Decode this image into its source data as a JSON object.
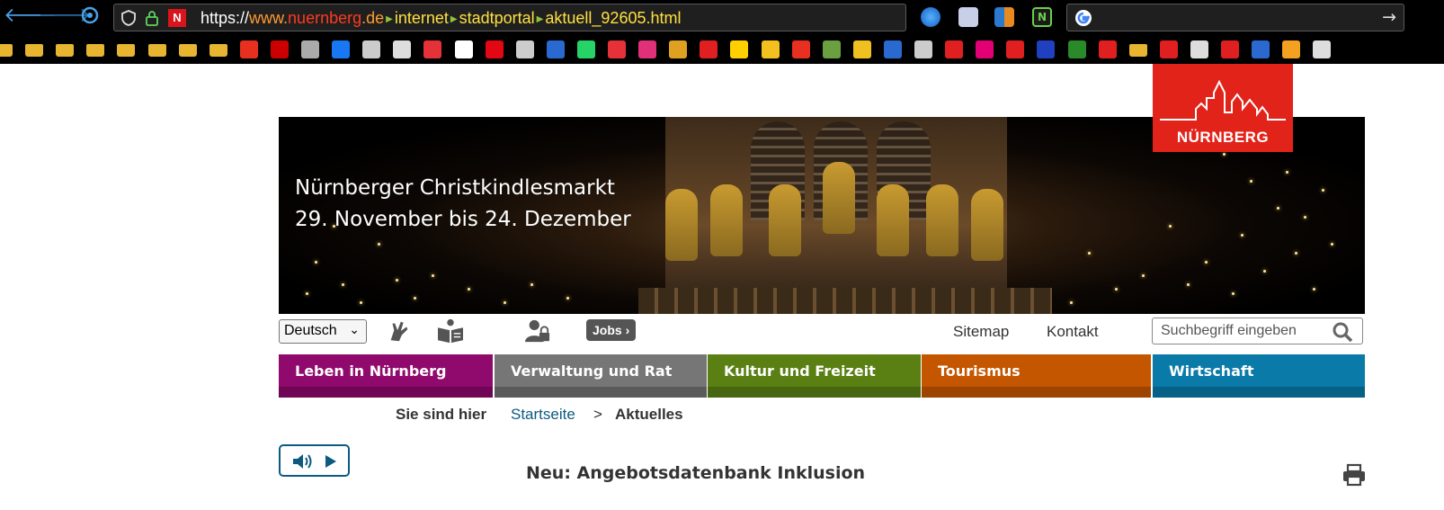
{
  "browser": {
    "url": {
      "scheme": "https://",
      "domain_prefix": "www.",
      "domain_name": "nuernberg",
      "domain_tld": ".de",
      "segments": [
        "internet",
        "stadtportal",
        "aktuell_92605.html"
      ]
    },
    "icons": [
      "back-arrow-icon",
      "forward-arrow-icon",
      "reader-icon",
      "shield-icon",
      "lock-icon",
      "site-favicon-n",
      "go-arrow-icon",
      "google-icon"
    ],
    "bookmark_count": 44
  },
  "site": {
    "logo_text": "NÜRNBERG",
    "hero": {
      "line1": "Nürnberger Christkindlesmarkt",
      "line2": "29. November bis 24. Dezember"
    },
    "tools": {
      "language": "Deutsch",
      "jobs_label": "Jobs",
      "sitemap": "Sitemap",
      "contact": "Kontakt",
      "search_placeholder": "Suchbegriff eingeben"
    },
    "nav": [
      {
        "label": "Leben in Nürnberg",
        "color": "#8f0a6c",
        "bar": "#6f0554"
      },
      {
        "label": "Verwaltung und Rat",
        "color": "#767676",
        "bar": "#5a5a5a"
      },
      {
        "label": "Kultur und Freizeit",
        "color": "#5a7f12",
        "bar": "#466610"
      },
      {
        "label": "Tourismus",
        "color": "#c45600",
        "bar": "#9c4400"
      },
      {
        "label": "Wirtschaft",
        "color": "#0a7aa8",
        "bar": "#076085"
      }
    ],
    "breadcrumb": {
      "prefix": "Sie sind hier",
      "home": "Startseite",
      "separator": ">",
      "current": "Aktuelles"
    },
    "headline": "Neu: Angebotsdatenbank Inklusion"
  }
}
